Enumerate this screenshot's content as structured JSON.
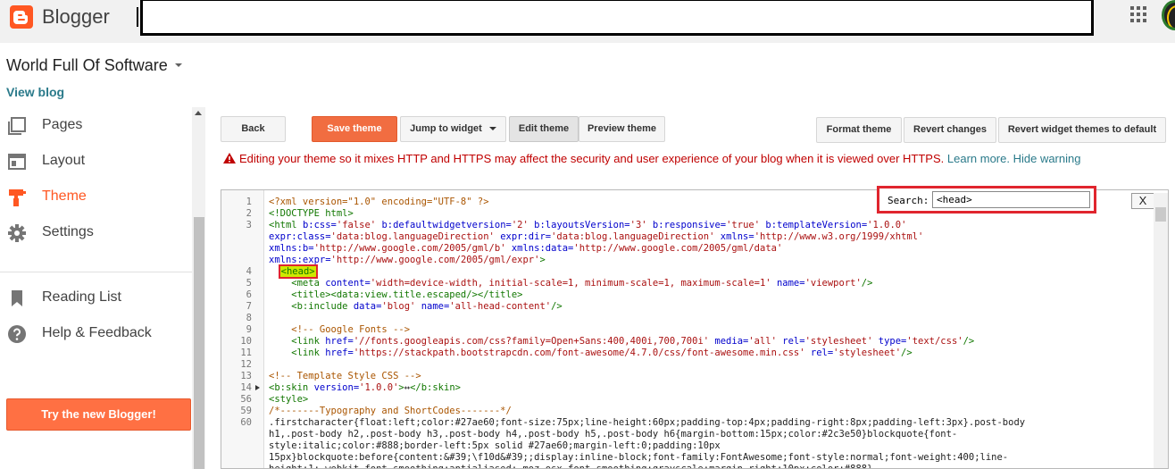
{
  "app": {
    "name": "Blogger"
  },
  "sidebar": {
    "blog_title": "World Full Of Software",
    "view_blog": "View blog",
    "items": [
      {
        "label": "Pages",
        "icon": "pages-icon",
        "active": false
      },
      {
        "label": "Layout",
        "icon": "layout-icon",
        "active": false
      },
      {
        "label": "Theme",
        "icon": "theme-icon",
        "active": true
      },
      {
        "label": "Settings",
        "icon": "settings-icon",
        "active": false
      },
      {
        "label": "Reading List",
        "icon": "bookmark-icon",
        "active": false
      },
      {
        "label": "Help & Feedback",
        "icon": "help-icon",
        "active": false
      }
    ],
    "try_new": "Try the new Blogger!"
  },
  "toolbar": {
    "back": "Back",
    "save_theme": "Save theme",
    "jump_to_widget": "Jump to widget",
    "edit_theme": "Edit theme",
    "preview_theme": "Preview theme",
    "format_theme": "Format theme",
    "revert_changes": "Revert changes",
    "revert_widget_themes": "Revert widget themes to default"
  },
  "warning": {
    "text": "Editing your theme so it mixes HTTP and HTTPS may affect the security and user experience of your blog when it is viewed over HTTPS.",
    "learn_more": "Learn more.",
    "hide_warning": "Hide warning"
  },
  "editor": {
    "search_label": "Search:",
    "search_value": "<head>",
    "close_label": "X",
    "line_numbers": [
      "1",
      "2",
      "3",
      "4",
      "5",
      "6",
      "7",
      "8",
      "9",
      "10",
      "11",
      "12",
      "13",
      "14",
      "56",
      "59",
      "60"
    ]
  },
  "colors": {
    "accent": "#ff5722",
    "save_button": "#f16d41",
    "link": "#2a7a8a",
    "warning": "#c00000",
    "highlight": "#e0252e"
  }
}
